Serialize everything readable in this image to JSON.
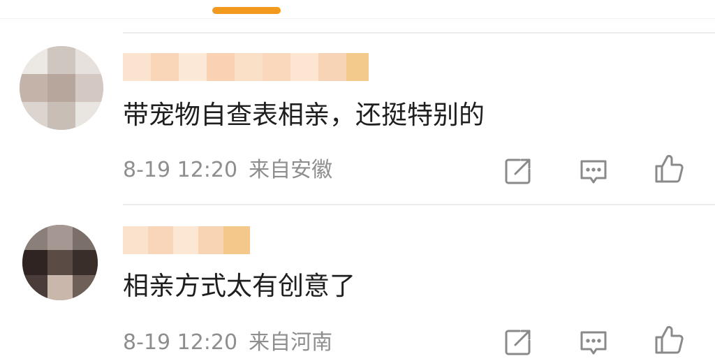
{
  "colors": {
    "accent": "#f39a1e",
    "text_primary": "#1e1e1e",
    "text_secondary": "#8e8e8e",
    "icon": "#8a8a8a"
  },
  "comments": [
    {
      "text": "带宠物自查表相亲，还挺特别的",
      "time": "8-19 12:20",
      "location": "来自安徽",
      "actions": [
        "share-icon",
        "comment-icon",
        "like-icon"
      ]
    },
    {
      "text": "相亲方式太有创意了",
      "time": "8-19 12:20",
      "location": "来自河南",
      "actions": [
        "share-icon",
        "comment-icon",
        "like-icon"
      ]
    }
  ]
}
